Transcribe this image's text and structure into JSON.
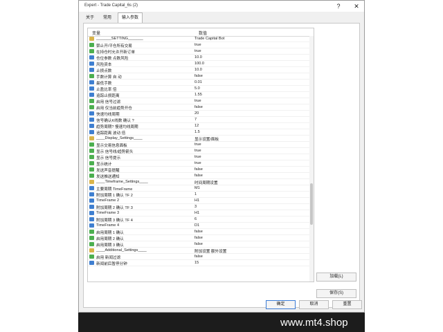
{
  "window": {
    "title": "Expert - Trade Capital_6s (2)",
    "help_label": "?",
    "close_label": "✕"
  },
  "tabs": [
    {
      "label": "关于"
    },
    {
      "label": "常用"
    },
    {
      "label": "输入参数",
      "active": true
    }
  ],
  "table": {
    "col_variable": "变量",
    "col_value": "数值",
    "rows": [
      {
        "icon": "str",
        "name": "_______SETTING_______",
        "value": "Trade Capital Bot"
      },
      {
        "icon": "bool",
        "name": "禁止开/平仓所有交易",
        "value": "true"
      },
      {
        "icon": "bool",
        "name": "在持仓时允许开新订单",
        "value": "true"
      },
      {
        "icon": "num",
        "name": "仓位参数 点数风险",
        "value": "10.0"
      },
      {
        "icon": "num",
        "name": "风险资本",
        "value": "100.0"
      },
      {
        "icon": "num",
        "name": "止损点数",
        "value": "10.0"
      },
      {
        "icon": "bool",
        "name": "手数计算 自 动",
        "value": "false"
      },
      {
        "icon": "num",
        "name": "最低手数",
        "value": "0.01"
      },
      {
        "icon": "num",
        "name": "止盈比率        倍",
        "value": "5.0"
      },
      {
        "icon": "num",
        "name": "追踪止损距离",
        "value": "1.55"
      },
      {
        "icon": "bool",
        "name": "启用   信号过滤",
        "value": "true"
      },
      {
        "icon": "bool",
        "name": "启用   仅当前趋势开仓",
        "value": "false"
      },
      {
        "icon": "num",
        "name": "快速均线周期",
        "value": "20"
      },
      {
        "icon": "num",
        "name": "信号确认K线数 确认   ?",
        "value": "7"
      },
      {
        "icon": "num",
        "name": "趋势周期?  慢速均线周期",
        "value": "12"
      },
      {
        "icon": "num",
        "name": "追踪距离 波动   倍",
        "value": "1.5"
      },
      {
        "icon": "str",
        "name": "____Display_Settings____",
        "value": "显示设置/面板"
      },
      {
        "icon": "bool",
        "name": "显示交易信息面板",
        "value": "true"
      },
      {
        "icon": "bool",
        "name": "显示   信号线/趋势箭头",
        "value": "true"
      },
      {
        "icon": "bool",
        "name": "显示   信号提示",
        "value": "true"
      },
      {
        "icon": "bool",
        "name": "显示统计",
        "value": "true"
      },
      {
        "icon": "bool",
        "name": "发送声音提醒",
        "value": "false"
      },
      {
        "icon": "bool",
        "name": "发送推送通知",
        "value": "false"
      },
      {
        "icon": "str",
        "name": "____Timeframe_Settings____",
        "value": "时间周期设置"
      },
      {
        "icon": "num",
        "name": "主要周期 TimeFrame",
        "value": "M1"
      },
      {
        "icon": "num",
        "name": "附加周期 1 确认    TF 2",
        "value": "1"
      },
      {
        "icon": "num",
        "name": "TimeFrame 2",
        "value": "H1"
      },
      {
        "icon": "num",
        "name": "附加周期 2 确认    TF 3",
        "value": "3"
      },
      {
        "icon": "num",
        "name": "TimeFrame 3",
        "value": "H1"
      },
      {
        "icon": "num",
        "name": "附加周期 3 确认    TF 4",
        "value": "6"
      },
      {
        "icon": "num",
        "name": "TimeFrame 4",
        "value": "D1"
      },
      {
        "icon": "bool",
        "name": "启用周期 1 确认",
        "value": "false"
      },
      {
        "icon": "bool",
        "name": "启用周期 2 确认",
        "value": "false"
      },
      {
        "icon": "bool",
        "name": "启用周期 3 确认",
        "value": "false"
      },
      {
        "icon": "str",
        "name": "____Additional_Settings____",
        "value": "附加设置   额外设置"
      },
      {
        "icon": "bool",
        "name": "启用   新闻过滤",
        "value": "false"
      },
      {
        "icon": "num",
        "name": "新闻前后暂停分钟",
        "value": "15"
      }
    ]
  },
  "buttons": {
    "load": "加载(L)",
    "save": "保存(S)",
    "ok": "确定",
    "cancel": "取消",
    "reset": "重置"
  },
  "watermark": "www.mt4.shop"
}
